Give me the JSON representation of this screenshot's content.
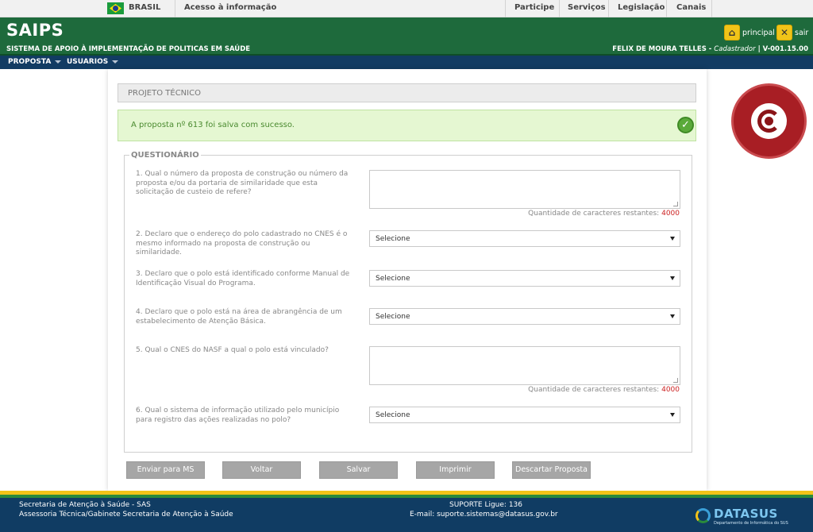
{
  "gov_bar": {
    "brasil": "BRASIL",
    "acesso": "Acesso à informação",
    "links": [
      "Participe",
      "Serviços",
      "Legislação",
      "Canais"
    ]
  },
  "header": {
    "title": "SAIPS",
    "subtitle": "SISTEMA DE APOIO À IMPLEMENTAÇÃO DE POLITICAS EM SAÚDE",
    "principal_label": "principal",
    "sair_label": "sair",
    "user_name": "FELIX DE MOURA TELLES -",
    "user_role": "Cadastrador",
    "version": "|   V-001.15.00"
  },
  "menu": {
    "items": [
      "PROPOSTA",
      "USUARIOS"
    ]
  },
  "section": {
    "title": "PROJETO TÉCNICO",
    "success_message": "A proposta nº 613 foi salva com sucesso."
  },
  "questionnaire": {
    "legend": "QUESTIONÁRIO",
    "counter_label": "Quantidade de caracteres restantes:",
    "counter_value": "4000",
    "select_default": "Selecione",
    "questions": [
      "1. Qual o número da proposta de construção ou número da proposta e/ou da portaria de similaridade que esta solicitação de custeio de refere?",
      "2. Declaro que o endereço do polo cadastrado no CNES é o mesmo informado na proposta de construção ou similaridade.",
      "3. Declaro que o polo está identificado conforme Manual de Identificação Visual do Programa.",
      "4. Declaro que o polo está na área de abrangência de um estabelecimento de Atenção Básica.",
      "5. Qual o CNES do NASF a qual o polo está vinculado?",
      "6. Qual o sistema de informação utilizado pelo município para registro das ações realizadas no polo?"
    ]
  },
  "buttons": {
    "enviar": "Enviar para MS",
    "voltar": "Voltar",
    "salvar": "Salvar",
    "imprimir": "Imprimir",
    "descartar": "Descartar Proposta"
  },
  "footer": {
    "left_line1": "Secretaria de Atenção à Saúde - SAS",
    "left_line2": "Assessoria Técnica/Gabinete Secretaria de Atenção à Saúde",
    "support_line": "SUPORTE Ligue: 136",
    "email_line": "E-mail: suporte.sistemas@datasus.gov.br",
    "logo_text": "DATASUS",
    "logo_sub": "Departamento de Informática do SUS"
  },
  "colors": {
    "header_green": "#1e6a3c",
    "menu_navy": "#123c63",
    "footer_navy": "#103c63",
    "success_bg": "#e5f7d2",
    "button_gray": "#a6a6a6"
  },
  "icons": [
    "brazil-flag-icon",
    "home-icon",
    "close-icon",
    "check-icon",
    "homologation-seal-icon",
    "datasus-logo-icon"
  ]
}
